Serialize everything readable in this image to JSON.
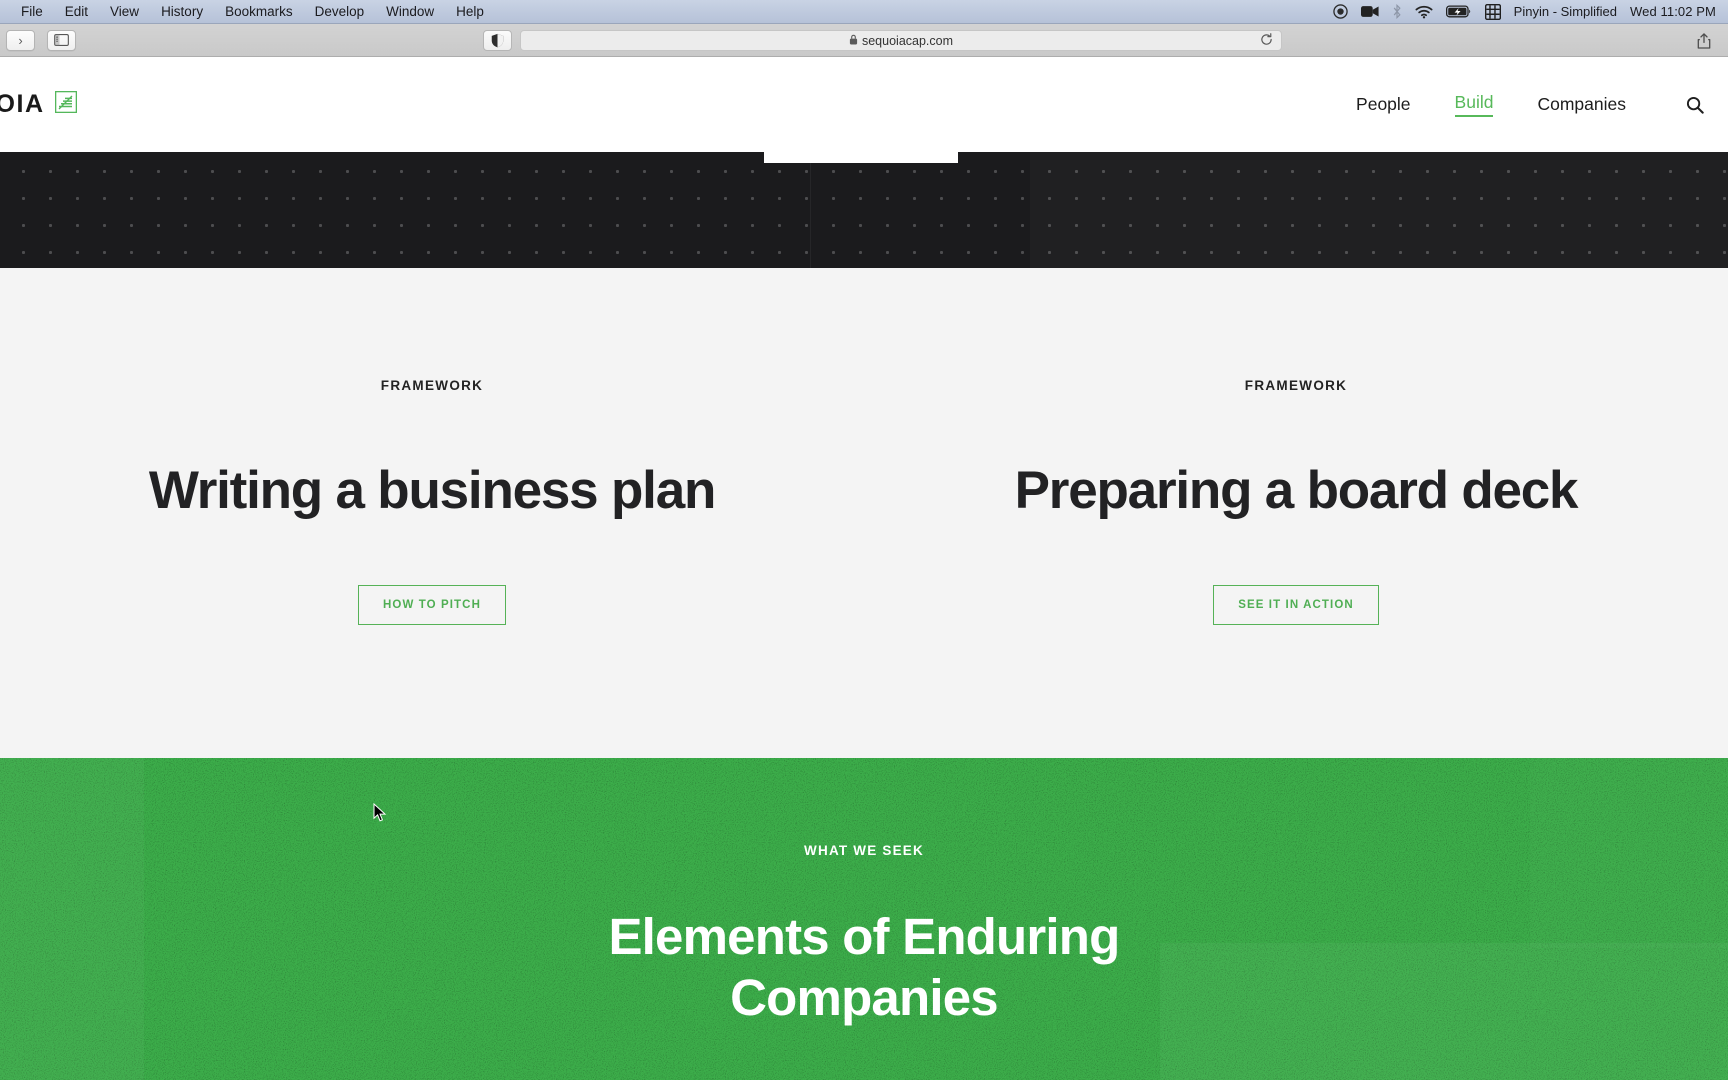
{
  "menubar": {
    "items": [
      "File",
      "Edit",
      "View",
      "History",
      "Bookmarks",
      "Develop",
      "Window",
      "Help"
    ],
    "status_icons": [
      "record-icon",
      "video-camera-icon",
      "bluetooth-icon",
      "wifi-icon",
      "battery-charging-icon",
      "input-source-icon"
    ],
    "input_source": "Pinyin - Simplified",
    "time": "Wed 11:02 PM"
  },
  "toolbar": {
    "back_label": "‹",
    "forward_label": "›",
    "sidebar_icon": "sidebar-icon",
    "shield_icon": "privacy-shield-icon",
    "lock_icon": "lock-icon",
    "url": "sequoiacap.com",
    "reload_icon": "reload-icon",
    "share_icon": "share-icon"
  },
  "site": {
    "logo_text": "UOIA",
    "logo_mark": "sequoia-tree-icon",
    "nav": [
      {
        "label": "People",
        "active": false
      },
      {
        "label": "Build",
        "active": true
      },
      {
        "label": "Companies",
        "active": false
      }
    ],
    "search_icon": "search-icon"
  },
  "cards": [
    {
      "eyebrow": "FRAMEWORK",
      "title": "Writing a business plan",
      "cta": "HOW TO PITCH"
    },
    {
      "eyebrow": "FRAMEWORK",
      "title": "Preparing a board deck",
      "cta": "SEE IT IN ACTION"
    }
  ],
  "green_section": {
    "eyebrow": "WHAT WE SEEK",
    "title": "Elements of Enduring Companies"
  },
  "colors": {
    "brand_green": "#3cad4a",
    "accent_green": "#57b95a",
    "dark_band": "#1b1b1d",
    "card_bg": "#f4f4f4",
    "text_dark": "#222224"
  }
}
